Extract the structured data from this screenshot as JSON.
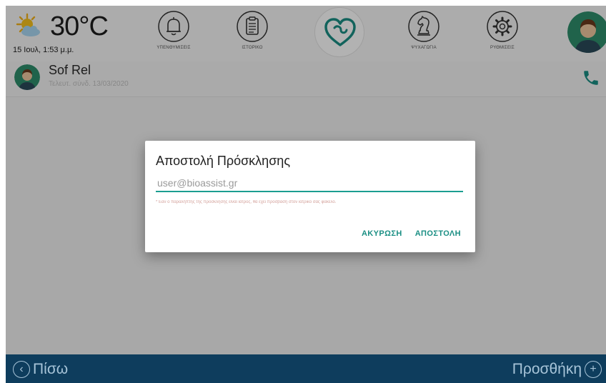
{
  "header": {
    "weather": {
      "temperature": "30°C",
      "icon": "sun-cloud-icon"
    },
    "datetime": "15 Ιουλ, 1:53 μ.μ.",
    "nav": [
      {
        "label": "ΥΠΕΝΘΥΜΙΣΕΙΣ",
        "icon": "bell-icon"
      },
      {
        "label": "ΙΣΤΟΡΙΚΟ",
        "icon": "clipboard-icon"
      },
      {
        "label": "",
        "icon": "heart-icon"
      },
      {
        "label": "ΨΥΧΑΓΩΓΙΑ",
        "icon": "chess-knight-icon"
      },
      {
        "label": "ΡΥΘΜΙΣΕΙΣ",
        "icon": "gear-icon"
      }
    ],
    "avatar_icon": "user-avatar-icon"
  },
  "contact": {
    "name": "Sof Rel",
    "subtitle": "Τελευτ. σύνδ. 13/03/2020",
    "call_icon": "phone-icon"
  },
  "dialog": {
    "title": "Αποστολή Πρόσκλησης",
    "email_placeholder": "user@bioassist.gr",
    "note": "* Εάν ο παραλήπτης της πρόσκλησης είναι ιατρός, θα έχει πρόσβαση στον ιατρικό σας φάκελο.",
    "cancel_label": "ΑΚΥΡΩΣΗ",
    "send_label": "ΑΠΟΣΤΟΛΗ"
  },
  "footer": {
    "back_label": "Πίσω",
    "add_label": "Προσθήκη"
  },
  "colors": {
    "accent": "#1b9e91",
    "footer_bg": "#0e3d5d",
    "footer_text": "#a7c4d8",
    "heart": "#1b8f84"
  }
}
